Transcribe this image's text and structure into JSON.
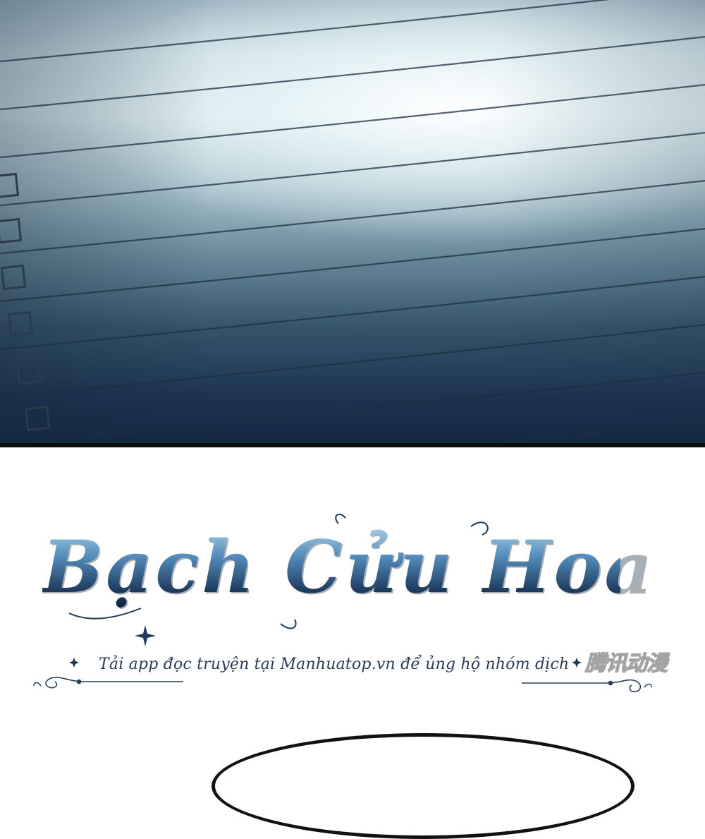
{
  "panel_top": {
    "description_icons": [
      "checkbox-icon",
      "checkbox-icon",
      "checkbox-icon",
      "checkbox-icon",
      "checkbox-icon",
      "checkbox-icon"
    ],
    "colors": {
      "light": "#e6f4f6",
      "mid": "#6f8fa0",
      "dark": "#142842",
      "lines": "#1e2f40"
    }
  },
  "title": {
    "series_name": "Bạch Cửu Hoa",
    "color_top": "#a8d4ee",
    "color_bottom": "#0f2038"
  },
  "credit": {
    "promo_text": "Tải app đọc truyện tại Manhuatop.vn để ủng hộ nhóm dịch",
    "watermark_text": "腾讯动漫"
  }
}
